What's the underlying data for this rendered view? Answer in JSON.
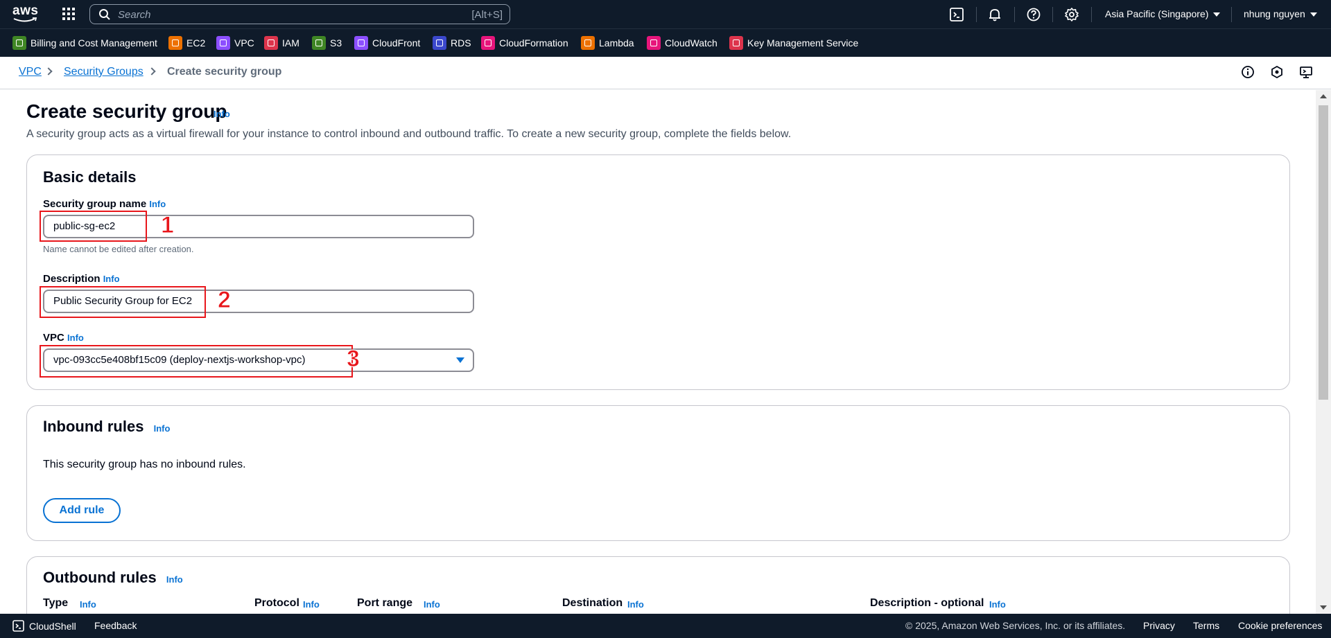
{
  "topnav": {
    "logo_text": "aws",
    "search_placeholder": "Search",
    "search_shortcut": "[Alt+S]",
    "region": "Asia Pacific (Singapore)",
    "user": "nhung nguyen",
    "icons": [
      "cloudshell-icon",
      "bell-icon",
      "help-icon",
      "gear-icon"
    ]
  },
  "favorites": [
    {
      "label": "Billing and Cost Management",
      "color": "#3f8624"
    },
    {
      "label": "EC2",
      "color": "#ed7100"
    },
    {
      "label": "VPC",
      "color": "#8c4fff"
    },
    {
      "label": "IAM",
      "color": "#dd344c"
    },
    {
      "label": "S3",
      "color": "#3f8624"
    },
    {
      "label": "CloudFront",
      "color": "#8c4fff"
    },
    {
      "label": "RDS",
      "color": "#3b48cc"
    },
    {
      "label": "CloudFormation",
      "color": "#e7157b"
    },
    {
      "label": "Lambda",
      "color": "#ed7100"
    },
    {
      "label": "CloudWatch",
      "color": "#e7157b"
    },
    {
      "label": "Key Management Service",
      "color": "#dd344c"
    }
  ],
  "breadcrumb": {
    "items": [
      "VPC",
      "Security Groups",
      "Create security group"
    ]
  },
  "page": {
    "title": "Create security group",
    "info": "Info",
    "description": "A security group acts as a virtual firewall for your instance to control inbound and outbound traffic. To create a new security group, complete the fields below."
  },
  "basic": {
    "title": "Basic details",
    "name_label": "Security group name",
    "name_value": "public-sg-ec2",
    "name_hint": "Name cannot be edited after creation.",
    "desc_label": "Description",
    "desc_value": "Public Security Group for EC2",
    "vpc_label": "VPC",
    "vpc_value": "vpc-093cc5e408bf15c09 (deploy-nextjs-workshop-vpc)",
    "info": "Info",
    "markers": [
      "1",
      "2",
      "3"
    ]
  },
  "inbound": {
    "title": "Inbound rules",
    "info": "Info",
    "empty_text": "This security group has no inbound rules.",
    "add_button": "Add rule"
  },
  "outbound": {
    "title": "Outbound rules",
    "info": "Info",
    "columns": [
      "Type",
      "Protocol",
      "Port range",
      "Destination",
      "Description - optional"
    ]
  },
  "footer": {
    "cloudshell": "CloudShell",
    "feedback": "Feedback",
    "copyright": "© 2025, Amazon Web Services, Inc. or its affiliates.",
    "privacy": "Privacy",
    "terms": "Terms",
    "cookies": "Cookie preferences"
  }
}
